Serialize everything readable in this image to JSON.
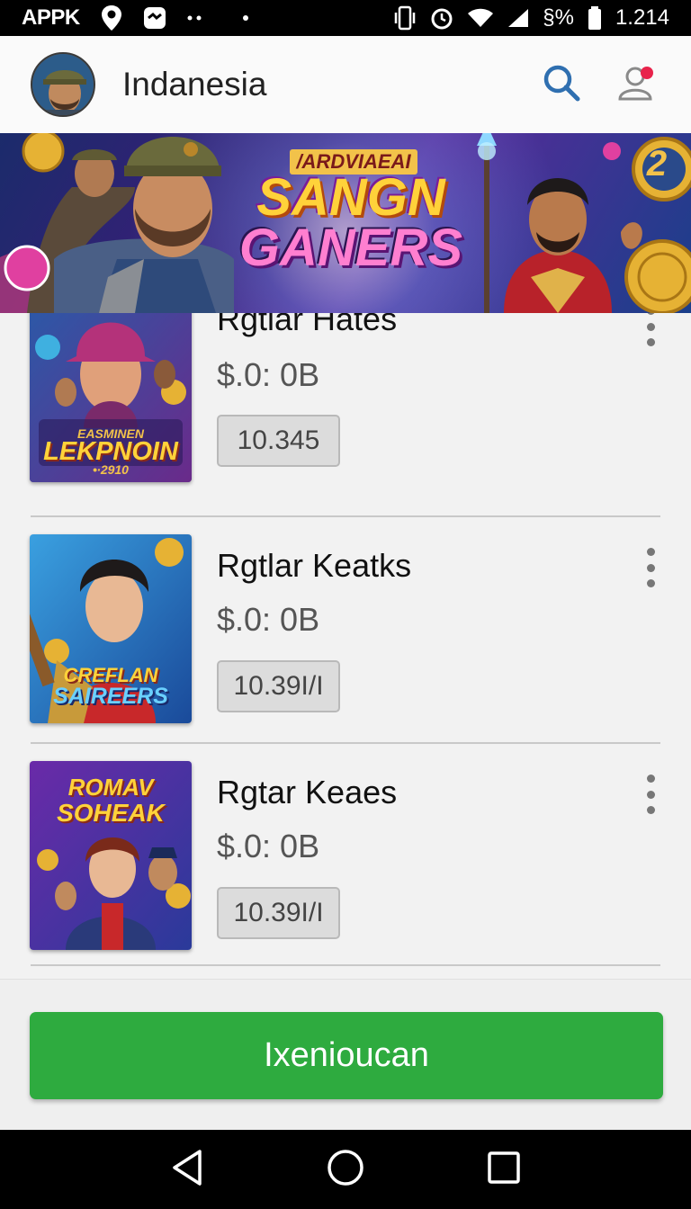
{
  "status_bar": {
    "carrier": "APPK",
    "battery_percent": "§%",
    "time": "1.214"
  },
  "header": {
    "title": "Indanesia",
    "search_icon": "search-icon",
    "profile_icon": "profile-icon",
    "has_notification": true
  },
  "banner": {
    "subtitle": "/ARDVIAEAI",
    "title_line1": "SANGN",
    "title_line2": "GANERS",
    "badge": "2"
  },
  "items": [
    {
      "title": "Rgtlar Hates",
      "price": "$.0:  0B",
      "tag": "10.345",
      "thumb_line1": "EASMINEN",
      "thumb_line2": "LEKPNOIN",
      "thumb_line3": "•∙2910"
    },
    {
      "title": "Rgtlar Keatks",
      "price": "$.0:  0B",
      "tag": "10.39I/I",
      "thumb_line1": "CREFLAN",
      "thumb_line2": "SAIREERS"
    },
    {
      "title": "Rgtar Keaes",
      "price": "$.0:  0B",
      "tag": "10.39I/I",
      "thumb_line1": "ROMAV",
      "thumb_line2": "SOHEAK"
    }
  ],
  "cta": {
    "label": "Ixenioucan"
  },
  "colors": {
    "cta_green": "#2eab3f",
    "accent_blue": "#2f6fb0",
    "notification_red": "#e8234b"
  }
}
